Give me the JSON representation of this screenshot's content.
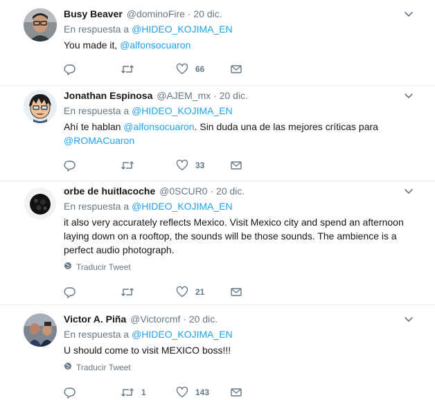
{
  "tweets": [
    {
      "name": "Busy Beaver",
      "handle": "@dominoFire",
      "dot": "·",
      "time": "20 dic.",
      "reply_prefix": "En respuesta a",
      "reply_to": "@HIDEO_KOJIMA_EN",
      "text_parts": [
        "You made it, ",
        "@alfonsocuaron"
      ],
      "replies": "",
      "retweets": "",
      "likes": "66"
    },
    {
      "name": "Jonathan Espinosa",
      "handle": "@AJEM_mx",
      "dot": "·",
      "time": "20 dic.",
      "reply_prefix": "En respuesta a",
      "reply_to": "@HIDEO_KOJIMA_EN",
      "text_parts": [
        "Ahí te hablan ",
        "@alfonsocuaron",
        ". Sin duda una de las mejores críticas para ",
        "@ROMACuaron"
      ],
      "replies": "",
      "retweets": "",
      "likes": "33"
    },
    {
      "name": "orbe de huitlacoche",
      "handle": "@0SCUR0",
      "dot": "·",
      "time": "20 dic.",
      "reply_prefix": "En respuesta a",
      "reply_to": "@HIDEO_KOJIMA_EN",
      "text": "it also very accurately reflects Mexico. Visit Mexico city and spend an afternoon laying down on a rooftop, the sounds will be those sounds. The ambience is a perfect audio photograph.",
      "translate": "Traducir Tweet",
      "replies": "",
      "retweets": "",
      "likes": "21"
    },
    {
      "name": "Victor A. Piña",
      "handle": "@Victorcmf",
      "dot": "·",
      "time": "20 dic.",
      "reply_prefix": "En respuesta a",
      "reply_to": "@HIDEO_KOJIMA_EN",
      "text": "U should come to visit MEXICO boss!!!",
      "translate": "Traducir Tweet",
      "replies": "",
      "retweets": "1",
      "likes": "143"
    }
  ],
  "icons": {
    "reply": "reply-icon",
    "retweet": "retweet-icon",
    "like": "heart-icon",
    "dm": "envelope-icon",
    "caret": "chevron-down-icon",
    "globe": "globe-icon"
  },
  "colors": {
    "link": "#1da1f2",
    "muted": "#657786",
    "text": "#14171a",
    "divider": "#e6ecf0"
  }
}
